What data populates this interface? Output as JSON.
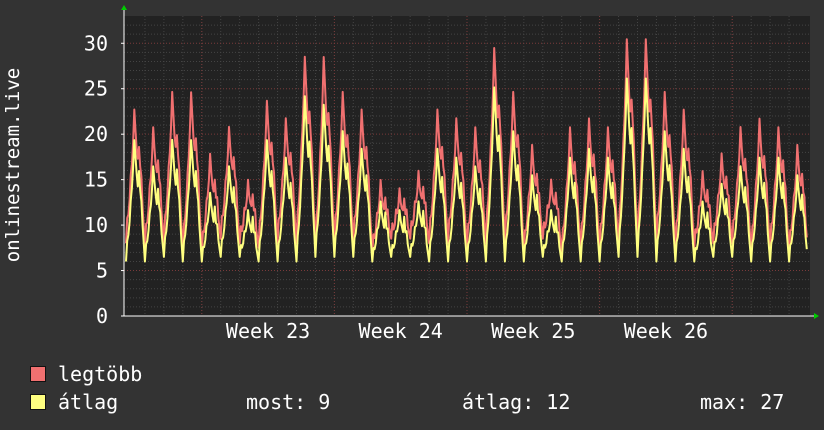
{
  "chart_data": {
    "type": "line",
    "ylabel": "onlinestream.live",
    "ylim": [
      0,
      33
    ],
    "yticks": [
      0,
      5,
      10,
      15,
      20,
      25,
      30
    ],
    "grid": true,
    "legend": "bottom-left",
    "x_ticks": [
      "Week 23",
      "Week 24",
      "Week 25",
      "Week 26"
    ],
    "series": [
      {
        "name": "legtöbb",
        "color": "#f07070",
        "daily_peaks": [
          22,
          20,
          24,
          24,
          17,
          20,
          14,
          23,
          21,
          28,
          28,
          24,
          22,
          14,
          13,
          15,
          22,
          21,
          20,
          29,
          24,
          18,
          14,
          20,
          21,
          20,
          30,
          30,
          24,
          22,
          15,
          17,
          20,
          21,
          20,
          18
        ],
        "daily_lows": [
          8,
          7.5,
          8,
          7,
          7,
          8.5,
          8,
          7.5,
          8,
          8,
          7.5,
          8,
          8,
          7,
          8.5,
          8.5,
          8,
          8,
          7.5,
          8,
          8,
          7,
          8.5,
          7,
          7.5,
          7.5,
          8,
          8,
          8,
          7.5,
          7.5,
          8,
          8,
          7,
          7.5,
          7
        ]
      },
      {
        "name": "átlag",
        "color": "#ffff80",
        "daily_peaks": [
          19,
          16,
          19,
          19,
          13,
          16,
          11,
          19,
          17,
          24,
          23,
          20,
          18,
          12,
          11,
          12,
          18,
          17,
          16,
          25,
          20,
          15,
          11,
          17,
          18,
          17,
          26,
          26,
          20,
          18,
          12,
          14,
          16,
          17,
          17,
          15
        ],
        "daily_lows": [
          6,
          6,
          6.5,
          6,
          6,
          6.5,
          6.5,
          6,
          6,
          6,
          6.5,
          6.5,
          6.5,
          6,
          6.5,
          6.5,
          6,
          6,
          6,
          6,
          6,
          6,
          6.5,
          6,
          6,
          6,
          6.5,
          6.5,
          6,
          6,
          6,
          6.5,
          6.5,
          6,
          6,
          6
        ]
      }
    ]
  },
  "legend": {
    "items": [
      {
        "label": "legtöbb",
        "color": "#f07070"
      },
      {
        "label": "átlag",
        "color": "#ffff80"
      }
    ],
    "stats": {
      "now": "most: 9",
      "avg": "átlag: 12",
      "max": "max: 27"
    }
  }
}
